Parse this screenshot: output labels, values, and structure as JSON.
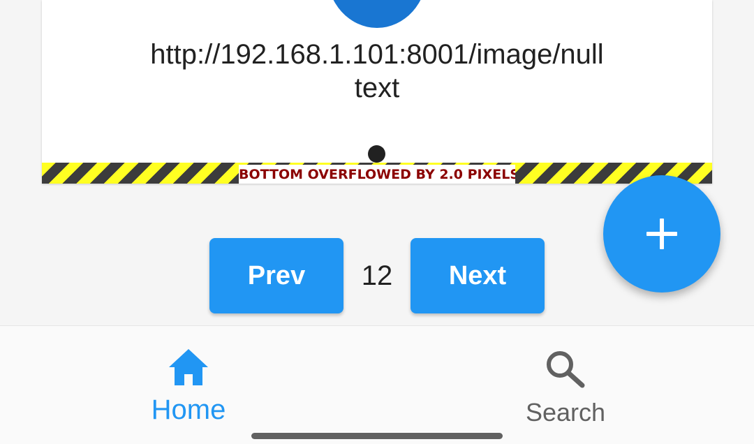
{
  "card": {
    "image_url": "http://192.168.1.101:8001/image/null",
    "text": "text",
    "overflow_warning": "BOTTOM OVERFLOWED BY 2.0 PIXELS"
  },
  "pagination": {
    "prev_label": "Prev",
    "page_number": "12",
    "next_label": "Next"
  },
  "fab": {
    "icon": "plus-icon"
  },
  "bottom_nav": {
    "items": [
      {
        "label": "Home",
        "icon": "home-icon",
        "active": true
      },
      {
        "label": "Search",
        "icon": "search-icon",
        "active": false
      }
    ]
  },
  "colors": {
    "accent": "#2196f3",
    "avatar": "#1976d2",
    "text_primary": "#212121",
    "text_secondary": "#616161",
    "overflow_text": "#8b0000",
    "stripe_yellow": "#ffff22",
    "stripe_dark": "#3c3c3c"
  }
}
